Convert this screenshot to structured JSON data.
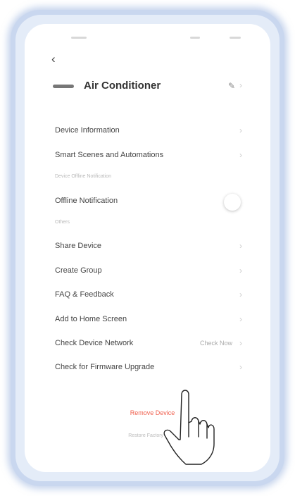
{
  "header": {
    "back_icon": "chevron-left-icon",
    "device_name": "Air Conditioner",
    "edit_icon": "pencil-icon"
  },
  "menu_top": [
    {
      "label": "Device Information"
    },
    {
      "label": "Smart Scenes and Automations"
    }
  ],
  "offline_section": {
    "header": "Device Offline Notification",
    "item_label": "Offline Notification",
    "toggle_state": "off"
  },
  "others_section": {
    "header": "Others",
    "items": [
      {
        "label": "Share Device"
      },
      {
        "label": "Create Group"
      },
      {
        "label": "FAQ & Feedback"
      },
      {
        "label": "Add to Home Screen"
      },
      {
        "label": "Check Device Network",
        "value": "Check Now"
      },
      {
        "label": "Check for Firmware Upgrade"
      }
    ]
  },
  "actions": {
    "remove_label": "Remove Device",
    "restore_label": "Restore Factory Def..."
  },
  "colors": {
    "danger": "#f0604e",
    "frame": "#c9d7ef"
  }
}
